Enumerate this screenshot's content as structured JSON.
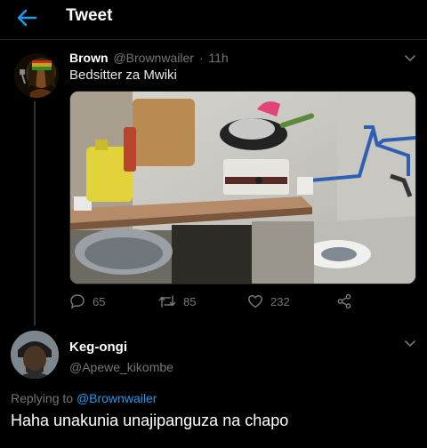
{
  "header": {
    "title": "Tweet"
  },
  "tweet": {
    "author_name": "Brown",
    "author_handle": "@Brownwailer",
    "separator": "·",
    "time": "11h",
    "text": "Bedsitter za Mwiki",
    "counts": {
      "replies": "65",
      "retweets": "85",
      "likes": "232"
    }
  },
  "reply": {
    "author_name": "Keg-ongi",
    "author_handle": "@Apewe_kikombe",
    "replying_prefix": "Replying to",
    "replying_handle": "@Brownwailer",
    "text": "Haha unakunia unajipanguza na chapo"
  },
  "icons": {
    "back": "arrow-left-icon",
    "more": "chevron-down-icon",
    "reply": "comment-icon",
    "retweet": "retweet-icon",
    "like": "heart-icon",
    "share": "share-icon"
  },
  "colors": {
    "background": "#000000",
    "accent": "#1d9bf0",
    "muted": "#71767b",
    "text": "#e7e9ea"
  }
}
